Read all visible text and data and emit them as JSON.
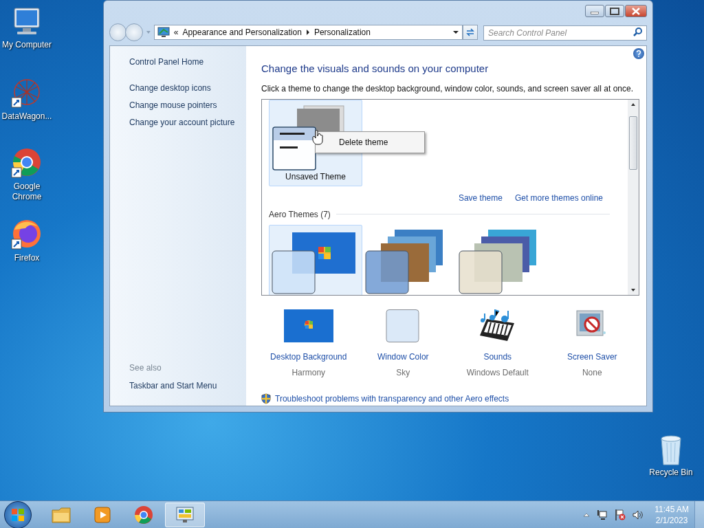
{
  "desktop_icons": [
    {
      "label": "My Computer",
      "kind": "computer"
    },
    {
      "label": "DataWagon...",
      "kind": "datawagon"
    },
    {
      "label": "Google Chrome",
      "kind": "chrome"
    },
    {
      "label": "Firefox",
      "kind": "firefox"
    }
  ],
  "recycle_bin": {
    "label": "Recycle Bin"
  },
  "window": {
    "breadcrumb": [
      "«",
      "Appearance and Personalization",
      "Personalization"
    ],
    "search": {
      "placeholder": "Search Control Panel"
    }
  },
  "sidebar": {
    "links": [
      "Control Panel Home",
      "Change desktop icons",
      "Change mouse pointers",
      "Change your account picture"
    ],
    "see_also": {
      "heading": "See also",
      "links": [
        "Taskbar and Start Menu"
      ]
    }
  },
  "main": {
    "title": "Change the visuals and sounds on your computer",
    "description": "Click a theme to change the desktop background, window color, sounds, and screen saver all at once.",
    "my_themes": [
      {
        "label": "Unsaved Theme",
        "selected": true
      }
    ],
    "context_menu": [
      "Delete theme"
    ],
    "links": [
      "Save theme",
      "Get more themes online"
    ],
    "aero_heading": "Aero Themes (7)",
    "aero_themes": [
      {
        "kind": "windows",
        "selected": true
      },
      {
        "kind": "stack",
        "selected": false
      },
      {
        "kind": "nature",
        "selected": false
      }
    ],
    "settings": [
      {
        "kind": "background",
        "label": "Desktop Background",
        "value": "Harmony"
      },
      {
        "kind": "color",
        "label": "Window Color",
        "value": "Sky"
      },
      {
        "kind": "sounds",
        "label": "Sounds",
        "value": "Windows Default"
      },
      {
        "kind": "saver",
        "label": "Screen Saver",
        "value": "None"
      }
    ],
    "troubleshoot": "Troubleshoot problems with transparency and other Aero effects"
  },
  "taskbar": {
    "apps": [
      {
        "kind": "explorer",
        "selected": false
      },
      {
        "kind": "media",
        "selected": false
      },
      {
        "kind": "chrome",
        "selected": false
      },
      {
        "kind": "control",
        "selected": true
      }
    ],
    "time": "11:45 AM",
    "date": "2/1/2023"
  }
}
